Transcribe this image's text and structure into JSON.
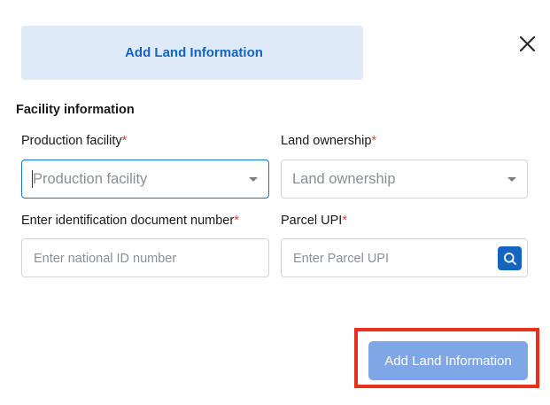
{
  "header": {
    "tab_title": "Add Land Information"
  },
  "section": {
    "title": "Facility information"
  },
  "fields": {
    "production_facility": {
      "label": "Production facility",
      "required_mark": "*",
      "placeholder": "Production facility"
    },
    "land_ownership": {
      "label": "Land ownership",
      "required_mark": "*",
      "placeholder": "Land ownership"
    },
    "id_number": {
      "label": "Enter identification document number",
      "required_mark": "*",
      "placeholder": "Enter national ID number"
    },
    "parcel_upi": {
      "label": "Parcel UPI",
      "required_mark": "*",
      "placeholder": "Enter Parcel UPI"
    }
  },
  "actions": {
    "submit_label": "Add Land Information"
  },
  "icons": {
    "close": "close-icon",
    "search": "search-icon",
    "dropdown": "chevron-down-icon"
  },
  "colors": {
    "accent": "#1565c0",
    "header_bg": "#deeaf7",
    "required": "#e53935",
    "submit_bg": "#7fa7e6",
    "highlight": "#e8301c",
    "focus_border": "#1976d2"
  }
}
